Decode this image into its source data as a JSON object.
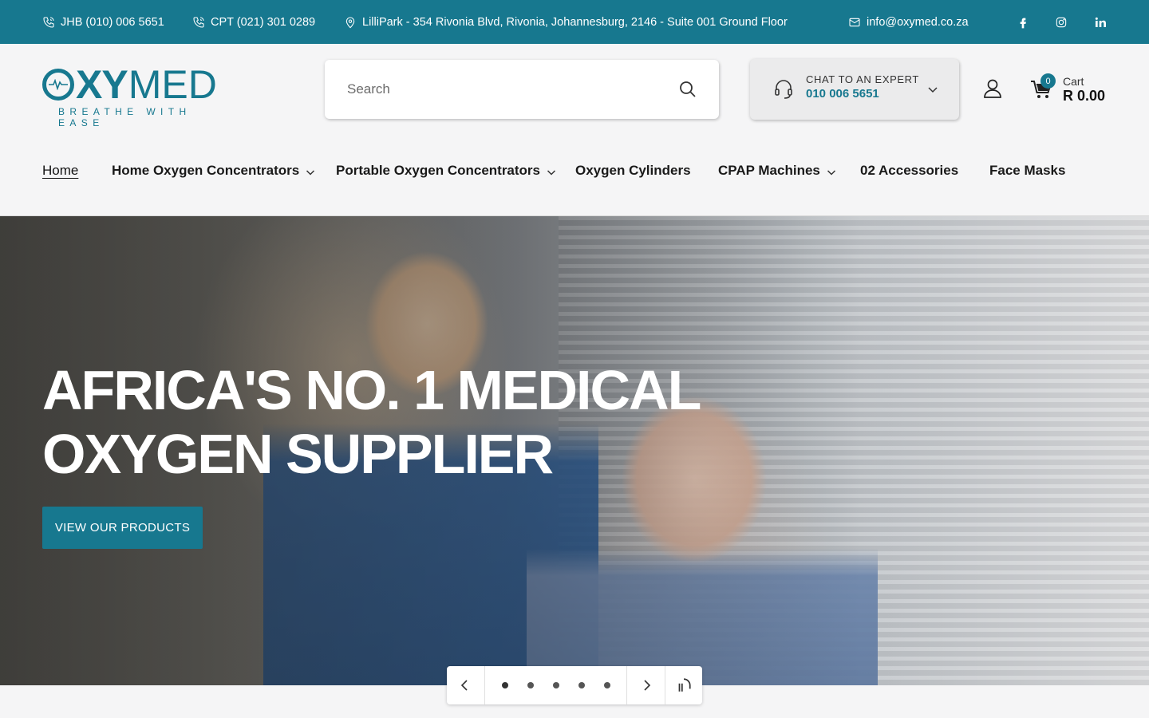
{
  "topbar": {
    "jhb_phone": "JHB (010) 006 5651",
    "cpt_phone": "CPT (021) 301 0289",
    "address": "LilliPark - 354 Rivonia Blvd, Rivonia, Johannesburg, 2146 - Suite 001 Ground Floor",
    "email": "info@oxymed.co.za",
    "social": [
      "facebook-icon",
      "instagram-icon",
      "linkedin-icon"
    ]
  },
  "logo": {
    "primary": "OXY",
    "secondary": "MED",
    "tagline": "BREATHE WITH EASE"
  },
  "search": {
    "placeholder": "Search"
  },
  "expert": {
    "label": "CHAT TO AN EXPERT",
    "number": "010 006 5651"
  },
  "cart": {
    "label": "Cart",
    "total": "R 0.00",
    "count": "0"
  },
  "nav": {
    "items": [
      {
        "label": "Home",
        "active": true,
        "dropdown": false
      },
      {
        "label": "Home Oxygen Concentrators",
        "dropdown": true
      },
      {
        "label": "Portable Oxygen Concentrators",
        "dropdown": true
      },
      {
        "label": "Oxygen Cylinders",
        "dropdown": false
      },
      {
        "label": "CPAP Machines",
        "dropdown": true
      },
      {
        "label": "02 Accessories",
        "dropdown": false
      },
      {
        "label": "Face Masks",
        "dropdown": false
      }
    ]
  },
  "hero": {
    "heading_line1": "AFRICA'S NO. 1 MEDICAL",
    "heading_line2": "OXYGEN SUPPLIER",
    "cta": "VIEW OUR PRODUCTS"
  },
  "slider": {
    "slide_count": 5,
    "active_index": 0
  },
  "colors": {
    "brand": "#17788f",
    "background": "#f5f5f6"
  }
}
